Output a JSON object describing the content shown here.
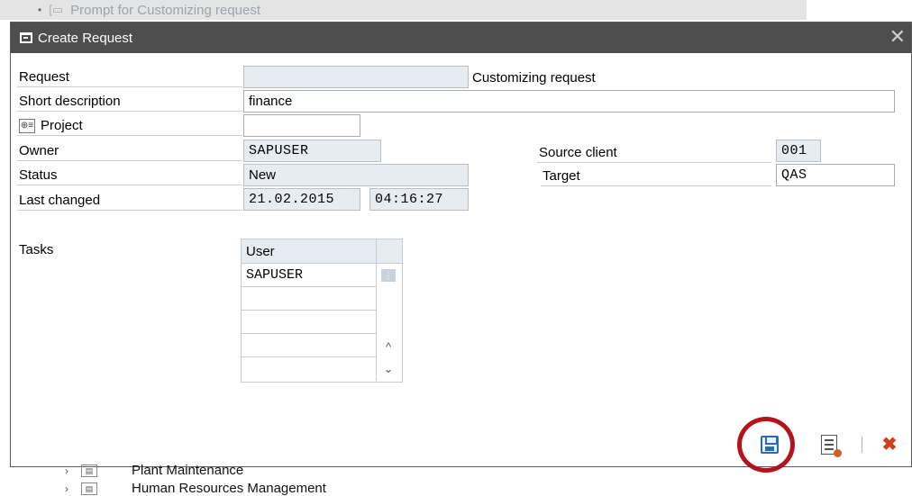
{
  "background": {
    "title": "Prompt for Customizing request",
    "tree_items": [
      "Plant Maintenance",
      "Human Resources Management"
    ]
  },
  "dialog": {
    "title": "Create Request",
    "close_symbol": "✕",
    "request_type": "Customizing request",
    "fields": {
      "request": {
        "label": "Request",
        "value": ""
      },
      "short_description": {
        "label": "Short description",
        "value": "finance"
      },
      "project": {
        "label": "Project",
        "value": ""
      },
      "owner": {
        "label": "Owner",
        "value": "SAPUSER"
      },
      "status": {
        "label": "Status",
        "value": "New"
      },
      "last_changed": {
        "label": "Last changed",
        "date": "21.02.2015",
        "time": "04:16:27"
      },
      "source_client": {
        "label": "Source client",
        "value": "001"
      },
      "target": {
        "label": "Target",
        "value": "QAS"
      }
    },
    "tasks": {
      "label": "Tasks",
      "column_header": "User",
      "rows": [
        "SAPUSER",
        "",
        "",
        "",
        ""
      ]
    },
    "toolbar": {
      "save_icon": "save-icon",
      "details_icon": "document-details-icon",
      "cancel_icon": "cancel-icon",
      "highlight_color": "#b3141b"
    }
  }
}
